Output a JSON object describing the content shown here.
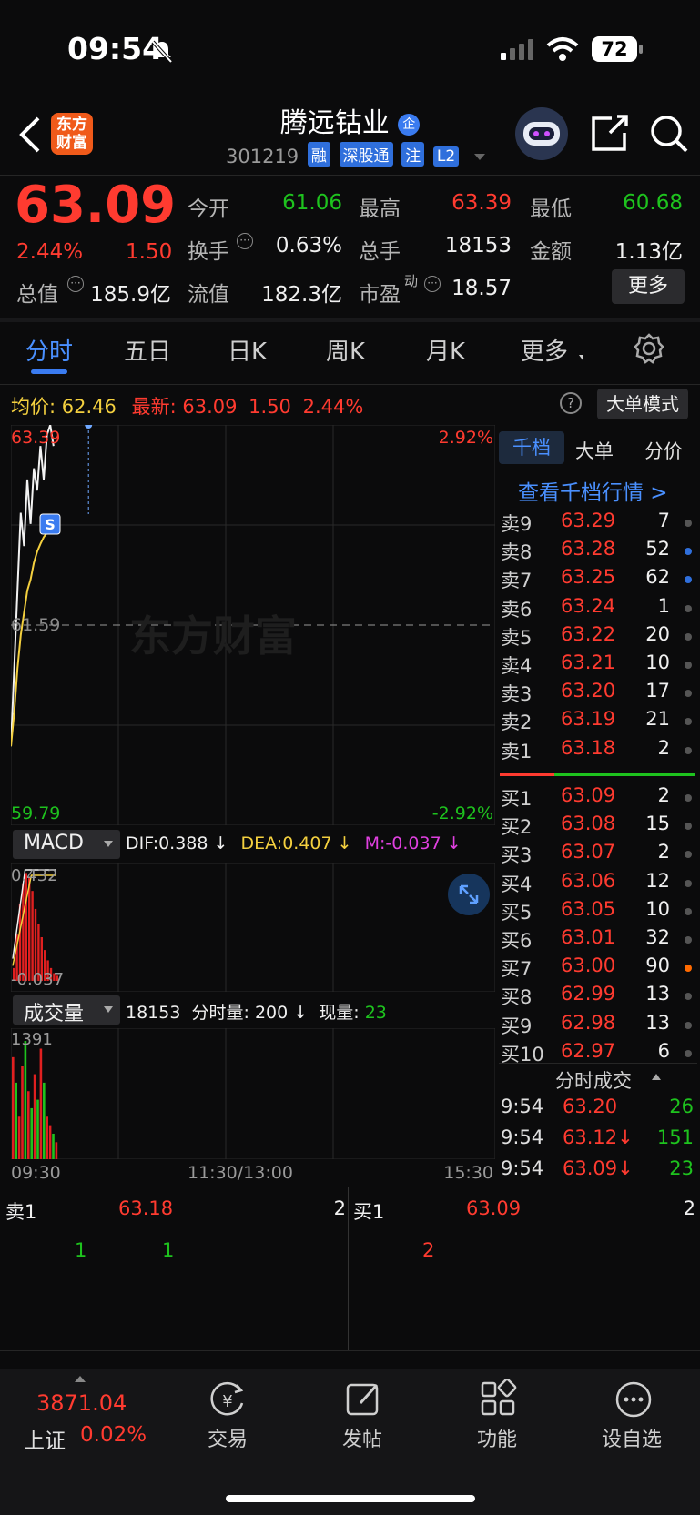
{
  "status_bar": {
    "time": "09:54",
    "battery": "72"
  },
  "header": {
    "title": "腾远钴业",
    "enterprise_badge": "企",
    "code": "301219",
    "tags": [
      "融",
      "深股通",
      "注",
      "L2"
    ],
    "logo_line1": "东方",
    "logo_line2": "财富"
  },
  "quote": {
    "price": "63.09",
    "change_pct": "2.44%",
    "change": "1.50",
    "open_label": "今开",
    "open": "61.06",
    "high_label": "最高",
    "high": "63.39",
    "low_label": "最低",
    "low": "60.68",
    "turnover_label": "换手",
    "turnover": "0.63%",
    "volume_label": "总手",
    "volume": "18153",
    "amount_label": "金额",
    "amount": "1.13亿",
    "total_cap_label": "总值",
    "total_cap": "185.9亿",
    "float_cap_label": "流值",
    "float_cap": "182.3亿",
    "pe_label": "市盈",
    "pe_sup": "动",
    "pe": "18.57",
    "more_button": "更多"
  },
  "tabs": [
    "分时",
    "五日",
    "日K",
    "周K",
    "月K",
    "更多"
  ],
  "chart_header": {
    "avg_label": "均价:",
    "avg": "62.46",
    "latest_label": "最新:",
    "latest": "63.09",
    "latest_change": "1.50",
    "latest_pct": "2.44%",
    "mode_button": "大单模式"
  },
  "chart_data": {
    "type": "line",
    "y_top": "63.39",
    "y_mid": "61.59",
    "y_bottom": "59.79",
    "pct_top": "2.92%",
    "pct_bottom": "-2.92%",
    "ylim": [
      59.79,
      63.39
    ],
    "x_labels": [
      "09:30",
      "11:30/13:00",
      "15:30"
    ],
    "series": [
      {
        "values": [
          60.5,
          61.2,
          61.9,
          62.6,
          62.3,
          62.9,
          62.5,
          63.0,
          62.8,
          63.2,
          62.9,
          63.3,
          63.39,
          63.2
        ]
      },
      {
        "values": [
          60.5,
          60.8,
          61.2,
          61.5,
          61.7,
          61.9,
          62.0,
          62.15,
          62.25,
          62.32,
          62.38,
          62.42,
          62.45,
          62.46
        ]
      }
    ],
    "macd": {
      "label": "MACD",
      "dif": "DIF:0.388 ↓",
      "dea": "DEA:0.407 ↓",
      "m": "M:-0.037 ↓",
      "top": "0.432",
      "bottom": "-0.037",
      "hist": [
        0.05,
        0.18,
        0.3,
        0.38,
        0.42,
        0.4,
        0.35,
        0.28,
        0.22,
        0.17,
        0.12,
        0.08,
        0.05,
        0.03,
        0.02
      ]
    },
    "volume": {
      "label": "成交量",
      "total": "18153",
      "minute_label": "分时量:",
      "minute": "200 ↓",
      "now_label": "现量:",
      "now": "23",
      "top": "1391",
      "bars": [
        1200,
        900,
        500,
        1100,
        1391,
        800,
        600,
        1000,
        700,
        1300,
        900,
        500,
        400,
        300,
        200
      ],
      "colors": [
        "red",
        "green",
        "red",
        "red",
        "green",
        "red",
        "green",
        "red",
        "green",
        "red",
        "green",
        "red",
        "red",
        "green",
        "red"
      ]
    }
  },
  "depth": {
    "tabs": [
      "千档",
      "大单",
      "分价"
    ],
    "link": "查看千档行情 >",
    "asks": [
      {
        "label": "卖9",
        "price": "63.29",
        "vol": "7",
        "dot": "#555"
      },
      {
        "label": "卖8",
        "price": "63.28",
        "vol": "52",
        "dot": "#2f6fdc"
      },
      {
        "label": "卖7",
        "price": "63.25",
        "vol": "62",
        "dot": "#2f6fdc"
      },
      {
        "label": "卖6",
        "price": "63.24",
        "vol": "1",
        "dot": "#555"
      },
      {
        "label": "卖5",
        "price": "63.22",
        "vol": "20",
        "dot": "#555"
      },
      {
        "label": "卖4",
        "price": "63.21",
        "vol": "10",
        "dot": "#555"
      },
      {
        "label": "卖3",
        "price": "63.20",
        "vol": "17",
        "dot": "#555"
      },
      {
        "label": "卖2",
        "price": "63.19",
        "vol": "21",
        "dot": "#555"
      },
      {
        "label": "卖1",
        "price": "63.18",
        "vol": "2",
        "dot": "#555"
      }
    ],
    "bids": [
      {
        "label": "买1",
        "price": "63.09",
        "vol": "2",
        "dot": "#555"
      },
      {
        "label": "买2",
        "price": "63.08",
        "vol": "15",
        "dot": "#555"
      },
      {
        "label": "买3",
        "price": "63.07",
        "vol": "2",
        "dot": "#555"
      },
      {
        "label": "买4",
        "price": "63.06",
        "vol": "12",
        "dot": "#555"
      },
      {
        "label": "买5",
        "price": "63.05",
        "vol": "10",
        "dot": "#555"
      },
      {
        "label": "买6",
        "price": "63.01",
        "vol": "32",
        "dot": "#555"
      },
      {
        "label": "买7",
        "price": "63.00",
        "vol": "90",
        "dot": "#ff6a00"
      },
      {
        "label": "买8",
        "price": "62.99",
        "vol": "13",
        "dot": "#555"
      },
      {
        "label": "买9",
        "price": "62.98",
        "vol": "13",
        "dot": "#555"
      },
      {
        "label": "买10",
        "price": "62.97",
        "vol": "6",
        "dot": "#555"
      }
    ],
    "trades_title": "分时成交",
    "trades": [
      {
        "time": "9:54",
        "price": "63.20",
        "vol": "26"
      },
      {
        "time": "9:54",
        "price": "63.12↓",
        "vol": "151"
      },
      {
        "time": "9:54",
        "price": "63.09↓",
        "vol": "23"
      }
    ]
  },
  "queue": {
    "sell_label": "卖1",
    "sell_price": "63.18",
    "sell_vol": "2",
    "buy_label": "买1",
    "buy_price": "63.09",
    "buy_vol": "2",
    "sell_orders": [
      "1",
      "1"
    ],
    "buy_orders": [
      "2"
    ]
  },
  "bottom_nav": {
    "index_value": "3871.04",
    "index_name": "上证",
    "index_pct": "0.02%",
    "items": [
      "交易",
      "发帖",
      "功能",
      "设自选"
    ]
  },
  "watermark": "东方财富"
}
